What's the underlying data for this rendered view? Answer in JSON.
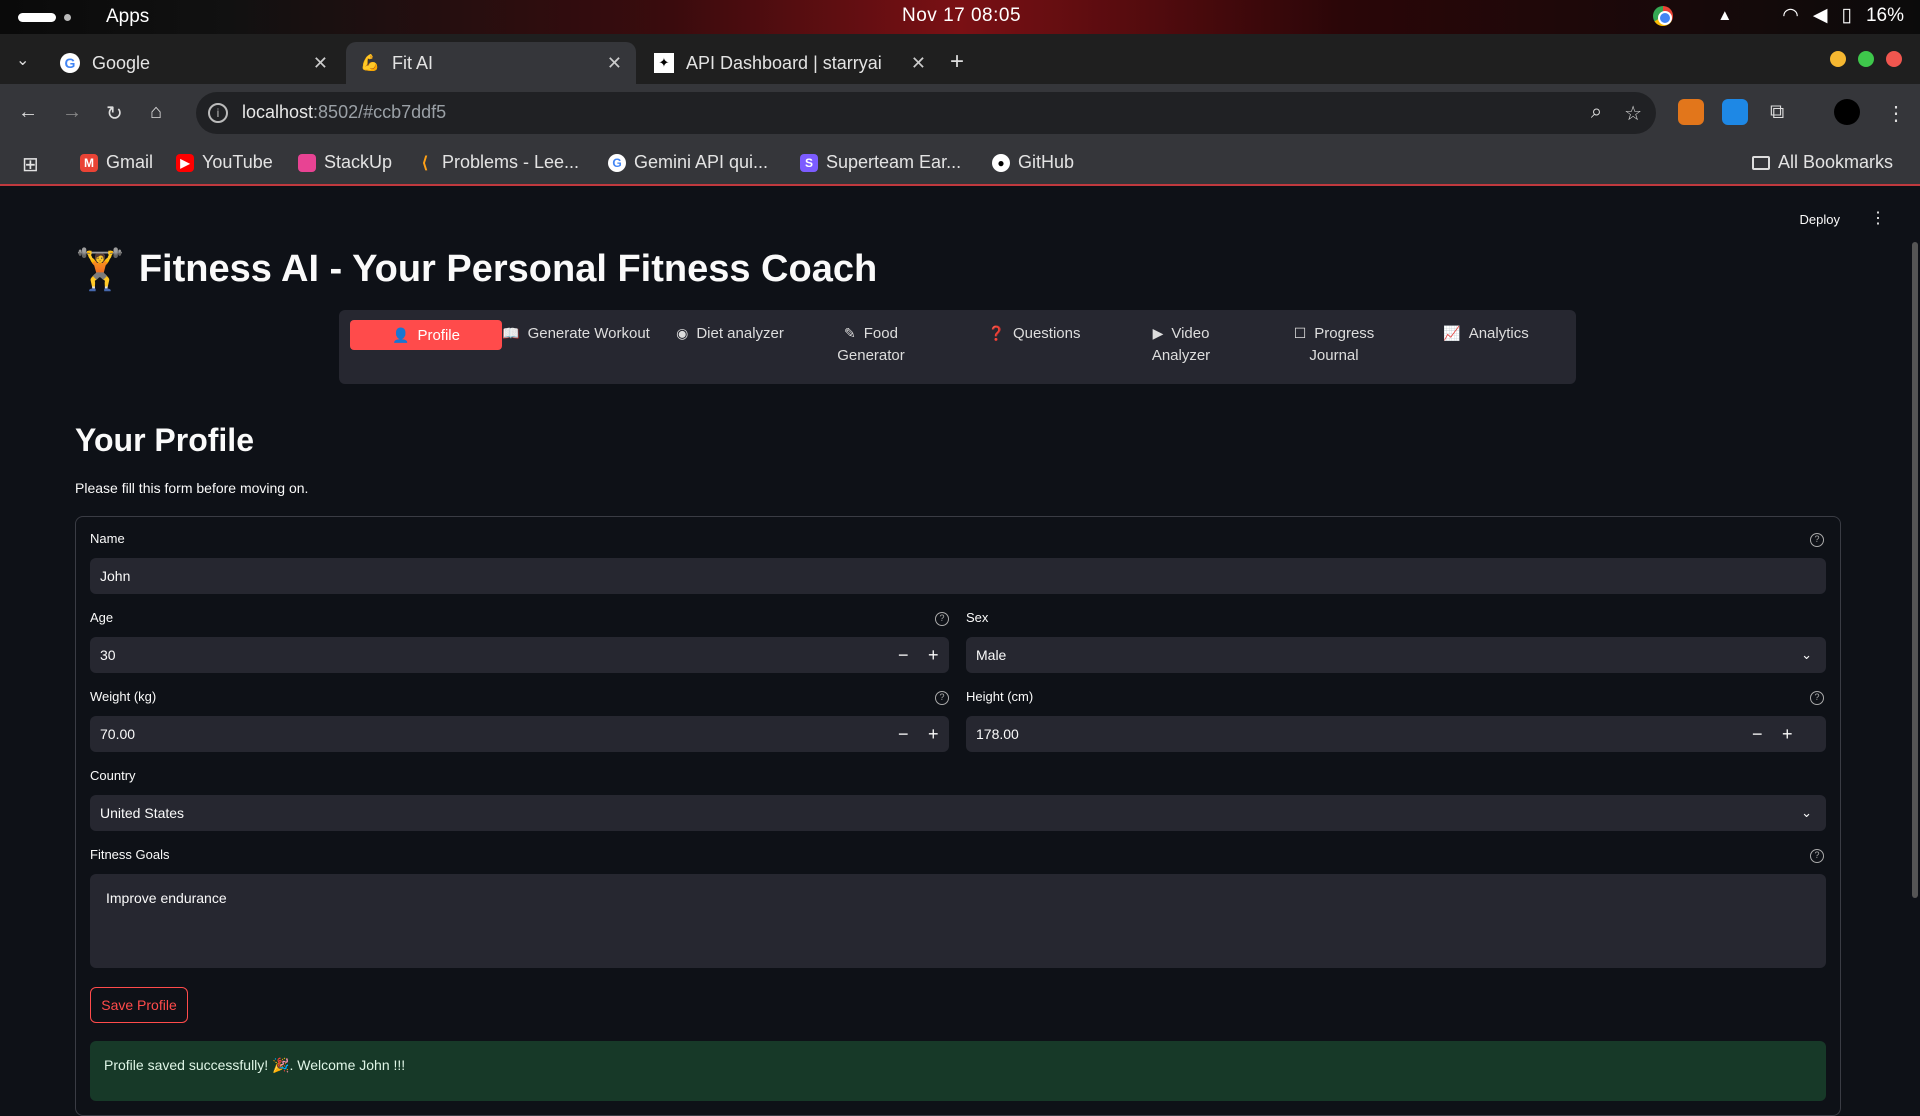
{
  "os": {
    "apps_label": "Apps",
    "clock": "Nov 17  08:05",
    "battery": "16%"
  },
  "tabs": [
    {
      "label": "Google",
      "icon": "google-icon"
    },
    {
      "label": "Fit AI",
      "icon": "flexed-bicep-icon"
    },
    {
      "label": "API Dashboard | starryai",
      "icon": "starryai-icon"
    }
  ],
  "address": {
    "url_host": "localhost",
    "url_rest": ":8502/#ccb7ddf5"
  },
  "bookmarks": [
    {
      "label": "Gmail",
      "color": "#ea4335"
    },
    {
      "label": "YouTube",
      "color": "#ff0000"
    },
    {
      "label": "StackUp",
      "color": "#e84393"
    },
    {
      "label": "Problems - Lee...",
      "color": "#ffa116"
    },
    {
      "label": "Gemini API qui...",
      "color": "#4285f4"
    },
    {
      "label": "Superteam Ear...",
      "color": "#7c5cff"
    },
    {
      "label": "GitHub",
      "color": "#ffffff"
    }
  ],
  "all_bookmarks": "All Bookmarks",
  "app": {
    "deploy": "Deploy",
    "title": "Fitness AI - Your Personal Fitness Coach",
    "title_emoji": "🏋️",
    "menu": [
      {
        "label": "Profile",
        "icon": "👤"
      },
      {
        "label": "Generate Workout",
        "icon": "📖"
      },
      {
        "label": "Diet analyzer",
        "icon": "◉"
      },
      {
        "label": "Food Generator",
        "icon": "✎"
      },
      {
        "label": "Questions",
        "icon": "❓"
      },
      {
        "label": "Video Analyzer",
        "icon": "▶"
      },
      {
        "label": "Progress Journal",
        "icon": "☐"
      },
      {
        "label": "Analytics",
        "icon": "📈"
      }
    ],
    "heading": "Your Profile",
    "subheading": "Please fill this form before moving on.",
    "form": {
      "name_label": "Name",
      "name_value": "John",
      "age_label": "Age",
      "age_value": "30",
      "sex_label": "Sex",
      "sex_value": "Male",
      "weight_label": "Weight (kg)",
      "weight_value": "70.00",
      "height_label": "Height (cm)",
      "height_value": "178.00",
      "country_label": "Country",
      "country_value": "United States",
      "goals_label": "Fitness Goals",
      "goals_value": "Improve endurance",
      "save_button": "Save Profile"
    },
    "success_message": "Profile saved successfully! 🎉. Welcome John !!!",
    "accent_color": "#ff4b4b"
  }
}
